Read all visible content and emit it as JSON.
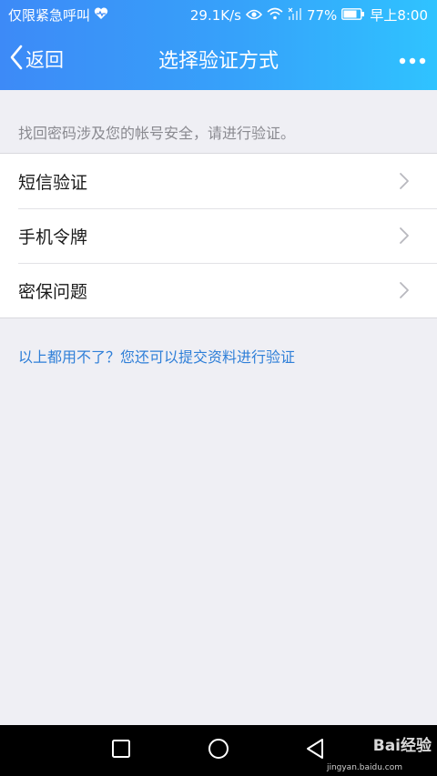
{
  "status_bar": {
    "carrier": "仅限紧急呼叫",
    "net_speed": "29.1K/s",
    "battery": "77%",
    "time": "早上8:00",
    "icons": [
      "heart-icon",
      "eye-icon",
      "wifi-icon",
      "signal-icon",
      "battery-icon"
    ]
  },
  "nav": {
    "back_label": "返回",
    "title": "选择验证方式",
    "more_icon": "more-dots-icon"
  },
  "hint": "找回密码涉及您的帐号安全，请进行验证。",
  "methods": [
    {
      "label": "短信验证"
    },
    {
      "label": "手机令牌"
    },
    {
      "label": "密保问题"
    }
  ],
  "alt_link": "以上都用不了？您还可以提交资料进行验证",
  "system_nav": [
    "recent-apps-icon",
    "home-icon",
    "back-triangle-icon"
  ],
  "watermark": {
    "text": "Bai经验",
    "sub": "jingyan.baidu.com"
  },
  "colors": {
    "header_start": "#3d8af7",
    "header_end": "#2fc3ff",
    "link": "#2f7fd8",
    "background": "#efeff4"
  }
}
